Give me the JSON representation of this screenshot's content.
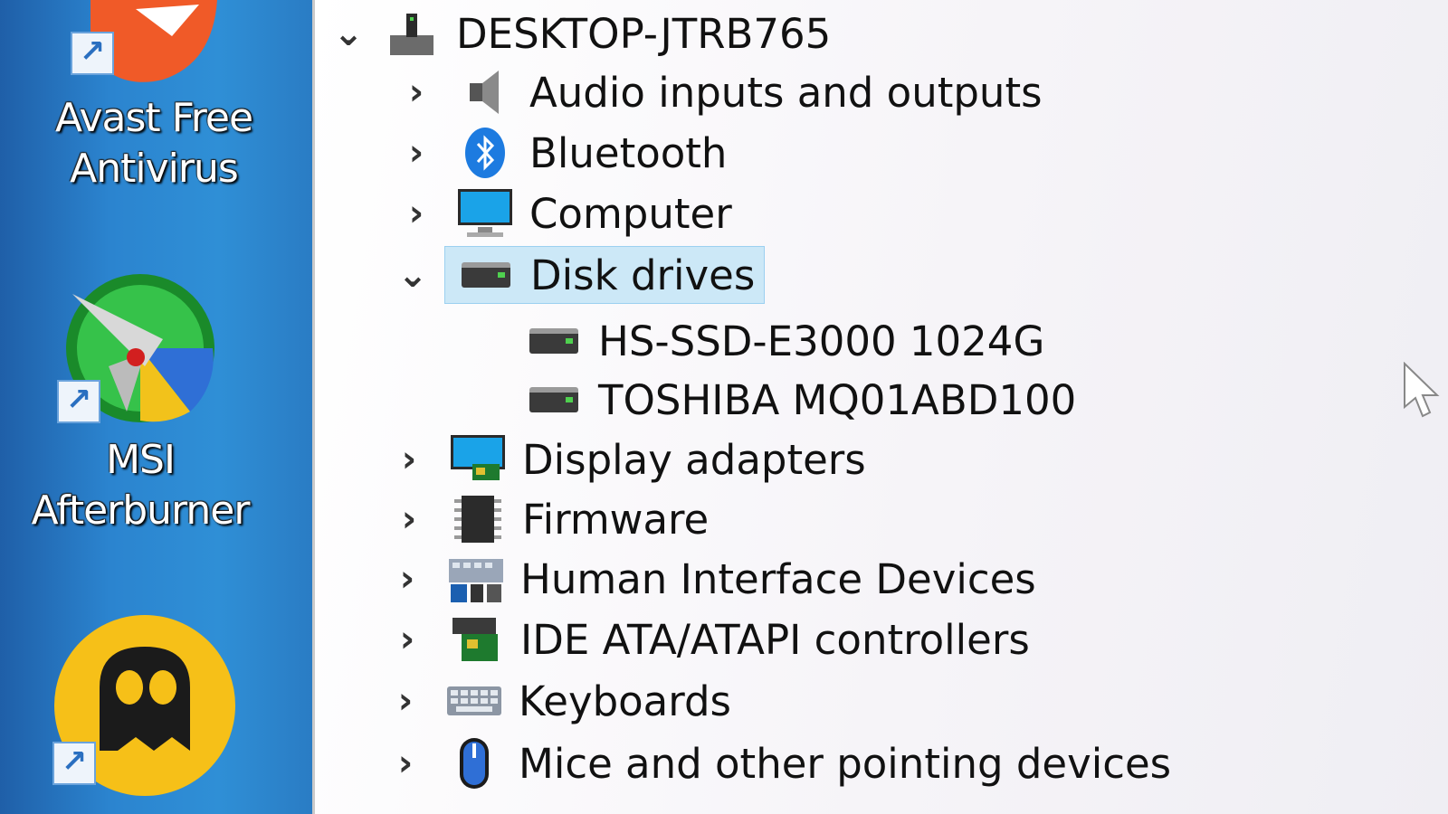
{
  "desktop": {
    "icons": [
      {
        "label": "Avast Free Antivirus",
        "icon": "avast-icon"
      },
      {
        "label": "MSI Afterburner",
        "icon": "msi-afterburner-icon"
      },
      {
        "label": "",
        "icon": "cyberghost-icon"
      }
    ]
  },
  "tree": {
    "root": "DESKTOP-JTRB765",
    "categories": [
      {
        "label": "Audio inputs and outputs",
        "icon": "speaker-icon",
        "expanded": false
      },
      {
        "label": "Bluetooth",
        "icon": "bluetooth-icon",
        "expanded": false
      },
      {
        "label": "Computer",
        "icon": "monitor-icon",
        "expanded": false
      },
      {
        "label": "Disk drives",
        "icon": "disk-drive-icon",
        "expanded": true,
        "selected": true,
        "children": [
          "HS-SSD-E3000 1024G",
          "TOSHIBA MQ01ABD100"
        ]
      },
      {
        "label": "Display adapters",
        "icon": "display-adapter-icon",
        "expanded": false
      },
      {
        "label": "Firmware",
        "icon": "chip-icon",
        "expanded": false
      },
      {
        "label": "Human Interface Devices",
        "icon": "hid-icon",
        "expanded": false
      },
      {
        "label": "IDE ATA/ATAPI controllers",
        "icon": "ide-controller-icon",
        "expanded": false
      },
      {
        "label": "Keyboards",
        "icon": "keyboard-icon",
        "expanded": false
      },
      {
        "label": "Mice and other pointing devices",
        "icon": "mouse-icon",
        "expanded": false
      }
    ]
  },
  "colors": {
    "selection": "#cce8f7",
    "desktop": "#2b84cf"
  }
}
